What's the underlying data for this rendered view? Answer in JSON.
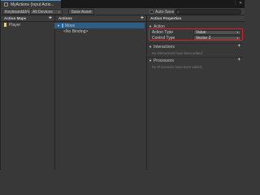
{
  "window": {
    "tab_title": "MyActions (Input Actio..."
  },
  "toolbar": {
    "control_scheme": "Keyboard&Mouse",
    "devices": "All Devices",
    "save_asset": "Save Asset",
    "auto_save": "Auto-Save",
    "search_placeholder": ""
  },
  "action_maps": {
    "header": "Action Maps",
    "items": [
      {
        "label": "Player"
      }
    ]
  },
  "actions": {
    "header": "Actions",
    "items": [
      {
        "label": "Move",
        "binding": "<No Binding>"
      }
    ]
  },
  "properties": {
    "header": "Action Properties",
    "action_section": "Action",
    "action_type_label": "Action Type",
    "action_type_value": "Value",
    "control_type_label": "Control Type",
    "control_type_value": "Vector 2",
    "interactions_section": "Interactions",
    "interactions_empty": "No Interactions have been added.",
    "processors_section": "Processors",
    "processors_empty": "No Processors have been added."
  },
  "colors": {
    "accent_selection": "#2c5d87",
    "highlight_box": "#d8202b",
    "map_marker": "#ffce3d",
    "action_marker": "#4db3ff"
  }
}
